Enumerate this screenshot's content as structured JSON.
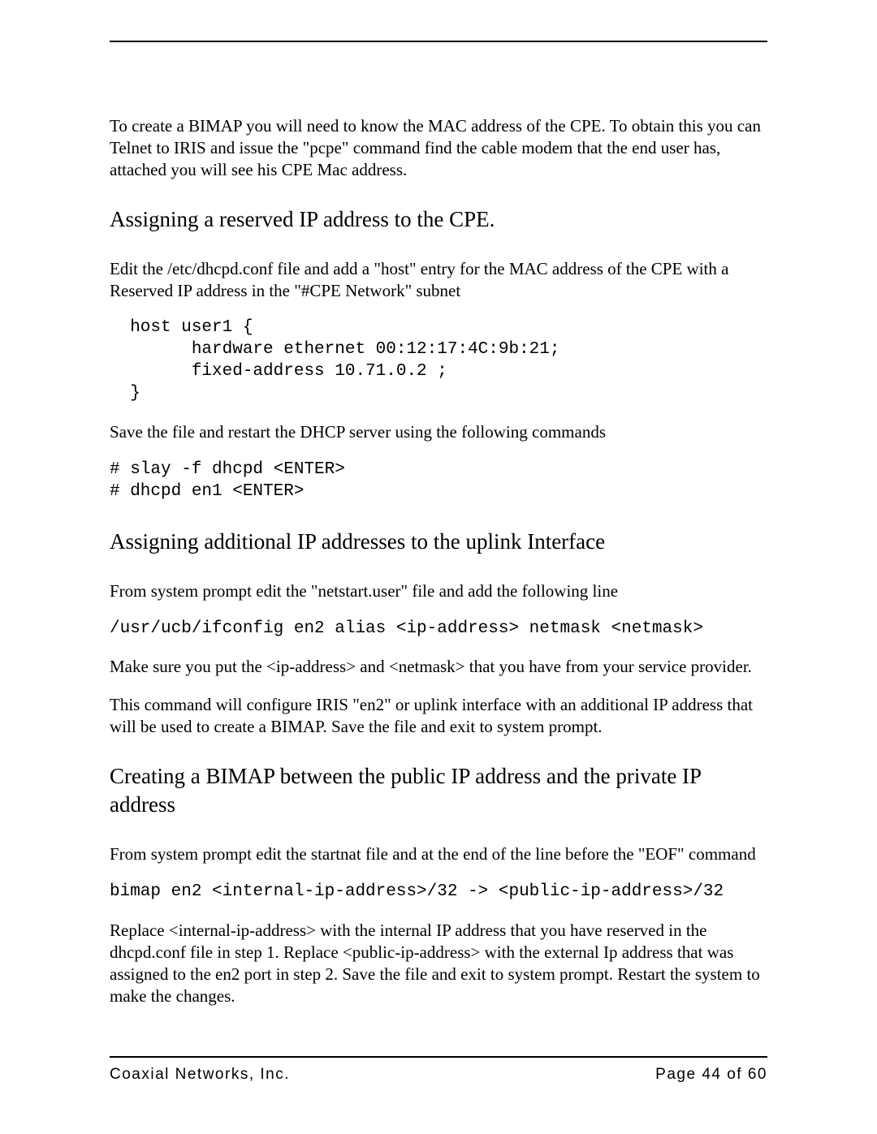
{
  "intro_para": "To create a BIMAP you will need to know the MAC address of the CPE. To obtain this you can Telnet to IRIS and issue the \"pcpe\" command find the cable modem that the end user has, attached you will see his CPE Mac address.",
  "section1": {
    "heading": "Assigning a reserved IP address to the CPE.",
    "para1": "Edit the /etc/dhcpd.conf file and add a \"host\" entry for the MAC address of the CPE with a Reserved IP address in the \"#CPE Network\" subnet",
    "code": "  host user1 {\n        hardware ethernet 00:12:17:4C:9b:21;\n        fixed-address 10.71.0.2 ;\n  }",
    "para2": "Save the file and restart the DHCP server using the following commands",
    "code2": "# slay -f dhcpd <ENTER>\n# dhcpd en1 <ENTER>"
  },
  "section2": {
    "heading": "Assigning additional IP addresses to the uplink Interface",
    "para1": "From system prompt edit the \"netstart.user\" file and add the following line",
    "code": "/usr/ucb/ifconfig en2 alias <ip-address> netmask <netmask>",
    "para2": "Make sure you put the <ip-address> and <netmask> that you have from your service provider.",
    "para3": "This command will configure IRIS \"en2\" or uplink interface with an additional IP address that will be used to create a BIMAP. Save the file and exit to system prompt."
  },
  "section3": {
    "heading": "Creating a BIMAP between the public IP address and the private IP address",
    "para1": "From system prompt edit the startnat file and at the end of the line before the \"EOF\" command",
    "code": "bimap en2 <internal-ip-address>/32 -> <public-ip-address>/32",
    "para2": "Replace <internal-ip-address> with the internal IP address that you have reserved in the dhcpd.conf file in step 1. Replace <public-ip-address> with the external Ip address that was assigned to the en2 port in step 2. Save the file and exit to system prompt. Restart the system to make the changes."
  },
  "footer": {
    "company": "Coaxial Networks, Inc.",
    "page": "Page 44 of 60"
  }
}
